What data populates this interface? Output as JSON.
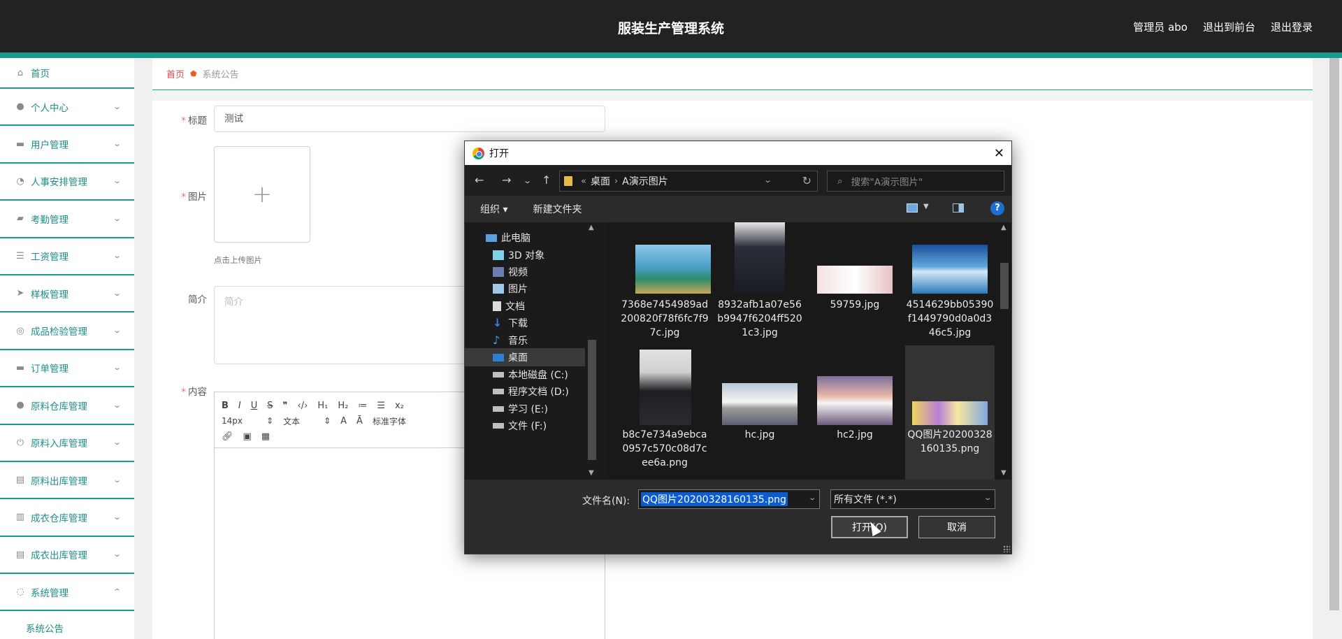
{
  "header": {
    "title": "服装生产管理系统",
    "links": [
      "管理员 abo",
      "退出到前台",
      "退出登录"
    ]
  },
  "sidebar": {
    "items": [
      {
        "label": "首页",
        "icon": "home-icon"
      },
      {
        "label": "个人中心",
        "icon": "user-icon"
      },
      {
        "label": "用户管理",
        "icon": "monitor-icon"
      },
      {
        "label": "人事安排管理",
        "icon": "dashboard-icon"
      },
      {
        "label": "考勤管理",
        "icon": "chat-icon"
      },
      {
        "label": "工资管理",
        "icon": "list-icon"
      },
      {
        "label": "样板管理",
        "icon": "send-icon"
      },
      {
        "label": "成品检验管理",
        "icon": "target-icon"
      },
      {
        "label": "订单管理",
        "icon": "monitor-icon"
      },
      {
        "label": "原料仓库管理",
        "icon": "user-icon"
      },
      {
        "label": "原料入库管理",
        "icon": "power-icon"
      },
      {
        "label": "原料出库管理",
        "icon": "clipboard-icon"
      },
      {
        "label": "成衣仓库管理",
        "icon": "bar-chart-icon"
      },
      {
        "label": "成衣出库管理",
        "icon": "clipboard-icon"
      },
      {
        "label": "系统管理",
        "icon": "compass-icon"
      }
    ],
    "sub_item": "系统公告"
  },
  "breadcrumb": {
    "home": "首页",
    "current": "系统公告"
  },
  "form": {
    "title_label": "标题",
    "title_value": "测试",
    "image_label": "图片",
    "upload_hint": "点击上传图片",
    "intro_label": "简介",
    "intro_placeholder": "简介",
    "content_label": "内容",
    "editor": {
      "font_size": "14px",
      "text_type": "文本",
      "font_family": "标准字体"
    }
  },
  "dialog": {
    "title": "打开",
    "path": [
      "桌面",
      "A演示图片"
    ],
    "search_placeholder": "搜索\"A演示图片\"",
    "organize": "组织 ▾",
    "new_folder": "新建文件夹",
    "tree": [
      {
        "label": "此电脑",
        "icon": "computer-icon"
      },
      {
        "label": "3D 对象",
        "icon": "cube-icon"
      },
      {
        "label": "视频",
        "icon": "video-icon"
      },
      {
        "label": "图片",
        "icon": "picture-icon"
      },
      {
        "label": "文档",
        "icon": "document-icon"
      },
      {
        "label": "下载",
        "icon": "download-icon"
      },
      {
        "label": "音乐",
        "icon": "music-icon"
      },
      {
        "label": "桌面",
        "icon": "desktop-icon",
        "selected": true
      },
      {
        "label": "本地磁盘 (C:)",
        "icon": "drive-icon"
      },
      {
        "label": "程序文档 (D:)",
        "icon": "drive-icon"
      },
      {
        "label": "学习 (E:)",
        "icon": "drive-icon"
      },
      {
        "label": "文件 (F:)",
        "icon": "drive-icon"
      }
    ],
    "files": [
      {
        "name": "7368e7454989ad200820f78f6fc7f97c.jpg",
        "thumb": "beach-hut-icon"
      },
      {
        "name": "8932afb1a07e56b9947f6204ff5201c3.jpg",
        "thumb": "man-suit-icon"
      },
      {
        "name": "59759.jpg",
        "thumb": "banner-icon"
      },
      {
        "name": "4514629bb05390f1449790d0a0d346c5.jpg",
        "thumb": "lake-icon"
      },
      {
        "name": "b8c7e734a9ebca0957c570c08d7cee6a.png",
        "thumb": "woman-suit-icon"
      },
      {
        "name": "hc.jpg",
        "thumb": "train-icon"
      },
      {
        "name": "hc2.jpg",
        "thumb": "train-sunset-icon"
      },
      {
        "name": "QQ图片20200328160135.png",
        "thumb": "anime-icon",
        "selected": true
      }
    ],
    "filename_label": "文件名(N):",
    "filename_value": "QQ图片20200328160135.png",
    "filetype": "所有文件 (*.*)",
    "open_button": "打开(O)",
    "cancel_button": "取消"
  },
  "colors": {
    "accent": "#1a9c8c",
    "header_bg": "#222222",
    "dialog_bg": "#1f1f1f",
    "selection": "#0b5cd0"
  }
}
